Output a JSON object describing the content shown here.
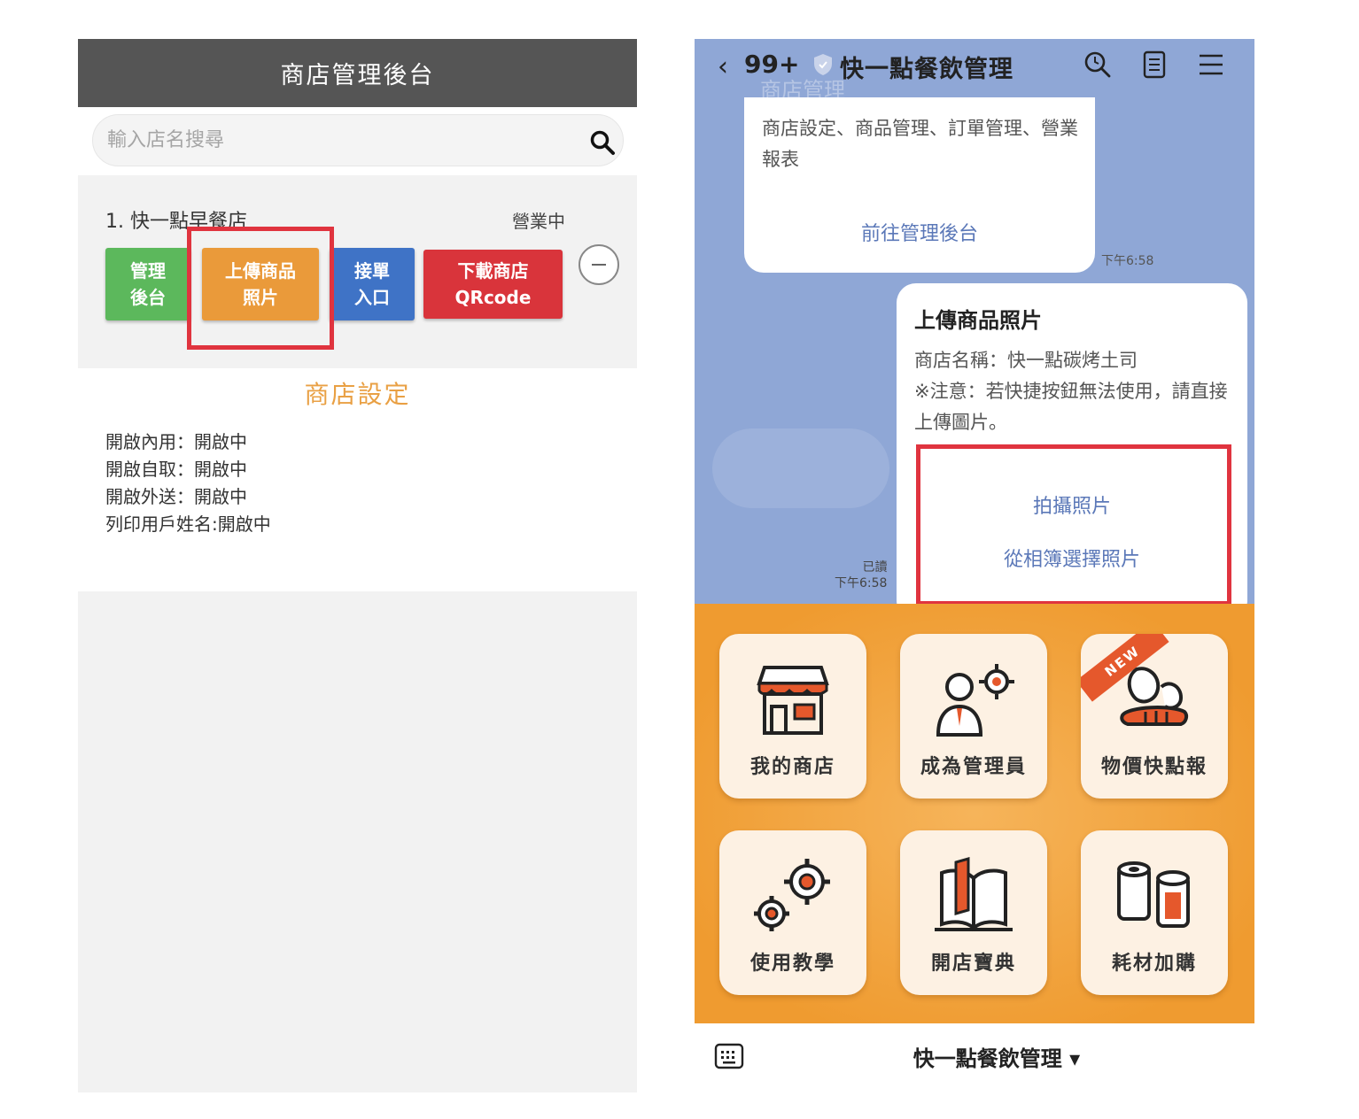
{
  "left_panel": {
    "header_title": "商店管理後台",
    "search_placeholder": "輸入店名搜尋",
    "store": {
      "name": "1. 快一點早餐店",
      "status": "營業中",
      "buttons": {
        "admin": [
          "管理",
          "後台"
        ],
        "upload": [
          "上傳商品",
          "照片"
        ],
        "order": [
          "接單",
          "入口"
        ],
        "qr": [
          "下載商店",
          "QRcode"
        ]
      }
    },
    "settings_title": "商店設定",
    "settings": [
      "開啟內用：開啟中",
      "開啟自取：開啟中",
      "開啟外送：開啟中",
      "列印用戶姓名:開啟中"
    ]
  },
  "right_panel": {
    "topbar": {
      "back_count": "99+",
      "title": "快一點餐飲管理",
      "ghost_text": "商店管理"
    },
    "message1": {
      "text": "商店設定、商品管理、訂單管理、營業報表",
      "link": "前往管理後台",
      "time": "下午6:58"
    },
    "message2": {
      "title": "上傳商品照片",
      "line1": "商店名稱：快一點碳烤土司",
      "line2": "※注意：若快捷按鈕無法使用，請直接上傳圖片。",
      "action1": "拍攝照片",
      "action2": "從相簿選擇照片",
      "read": "已讀",
      "time": "下午6:58"
    },
    "menu": {
      "tiles": [
        "我的商店",
        "成為管理員",
        "物價快點報",
        "使用教學",
        "開店寶典",
        "耗材加購"
      ],
      "new_badge": "NEW"
    },
    "bottombar": {
      "name": "快一點餐飲管理 ▾"
    }
  },
  "colors": {
    "header_gray": "#555555",
    "green": "#5cb85c",
    "orange": "#ea9a3a",
    "blue": "#3f73c6",
    "red": "#d9343b",
    "highlight": "#e0343f",
    "chat_bg": "#8fa7d6",
    "menu_bg": "#ef9b30"
  }
}
